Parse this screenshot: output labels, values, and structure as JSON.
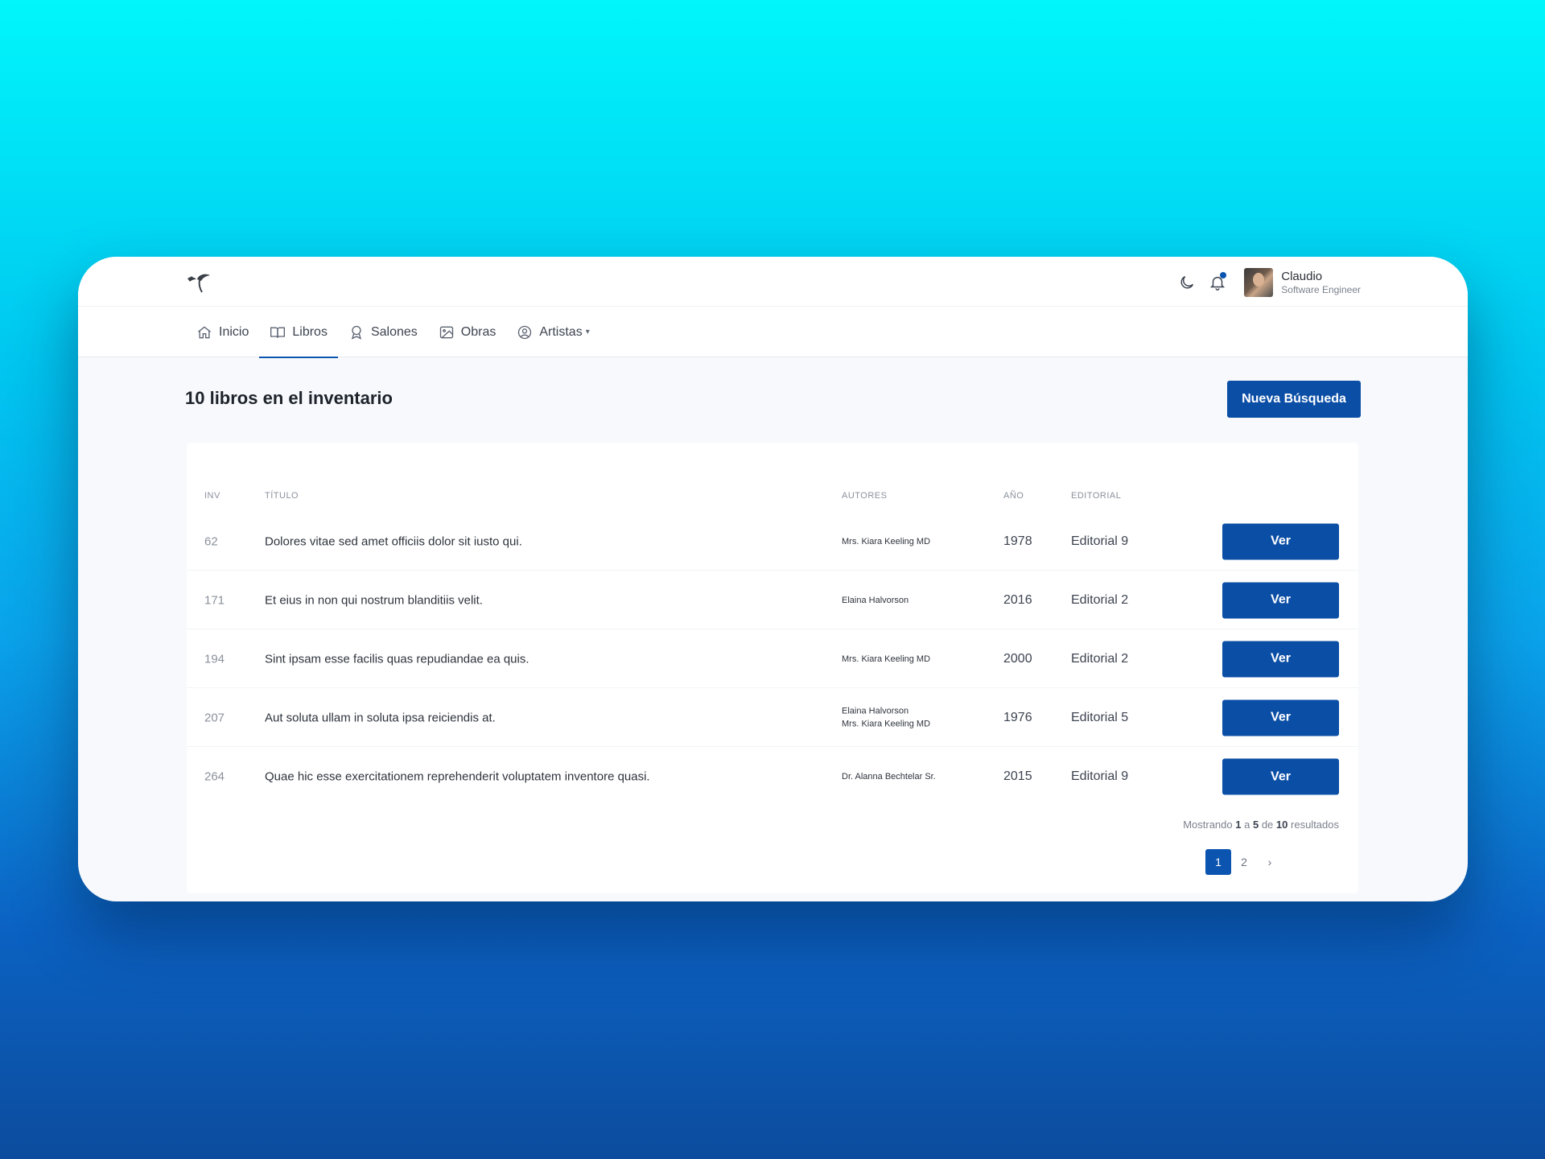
{
  "user": {
    "name": "Claudio",
    "role": "Software Engineer"
  },
  "nav": {
    "items": [
      {
        "label": "Inicio",
        "icon": "home-icon"
      },
      {
        "label": "Libros",
        "icon": "book-icon",
        "active": true
      },
      {
        "label": "Salones",
        "icon": "award-icon"
      },
      {
        "label": "Obras",
        "icon": "image-icon"
      },
      {
        "label": "Artistas",
        "icon": "user-circle-icon"
      }
    ]
  },
  "page": {
    "title": "10 libros en el inventario",
    "new_search_label": "Nueva Búsqueda"
  },
  "table": {
    "headers": {
      "inv": "INV",
      "title": "TÍTULO",
      "authors": "AUTORES",
      "year": "AÑO",
      "publisher": "EDITORIAL"
    },
    "view_label": "Ver",
    "rows": [
      {
        "inv": "62",
        "title": "Dolores vitae sed amet officiis dolor sit iusto qui.",
        "authors": [
          "Mrs. Kiara Keeling MD"
        ],
        "year": "1978",
        "publisher": "Editorial 9"
      },
      {
        "inv": "171",
        "title": "Et eius in non qui nostrum blanditiis velit.",
        "authors": [
          "Elaina Halvorson"
        ],
        "year": "2016",
        "publisher": "Editorial 2"
      },
      {
        "inv": "194",
        "title": "Sint ipsam esse facilis quas repudiandae ea quis.",
        "authors": [
          "Mrs. Kiara Keeling MD"
        ],
        "year": "2000",
        "publisher": "Editorial 2"
      },
      {
        "inv": "207",
        "title": "Aut soluta ullam in soluta ipsa reiciendis at.",
        "authors": [
          "Elaina Halvorson",
          "Mrs. Kiara Keeling MD"
        ],
        "year": "1976",
        "publisher": "Editorial 5"
      },
      {
        "inv": "264",
        "title": "Quae hic esse exercitationem reprehenderit voluptatem inventore quasi.",
        "authors": [
          "Dr. Alanna Bechtelar Sr."
        ],
        "year": "2015",
        "publisher": "Editorial 9"
      }
    ]
  },
  "pagination": {
    "summary": {
      "prefix": "Mostrando",
      "from": "1",
      "sep1": "a",
      "to": "5",
      "sep2": "de",
      "total": "10",
      "suffix": "resultados"
    },
    "pages": [
      "1",
      "2"
    ],
    "current": "1",
    "next": "›"
  },
  "colors": {
    "primary": "#0b4ea6",
    "accent": "#0b54b0"
  }
}
